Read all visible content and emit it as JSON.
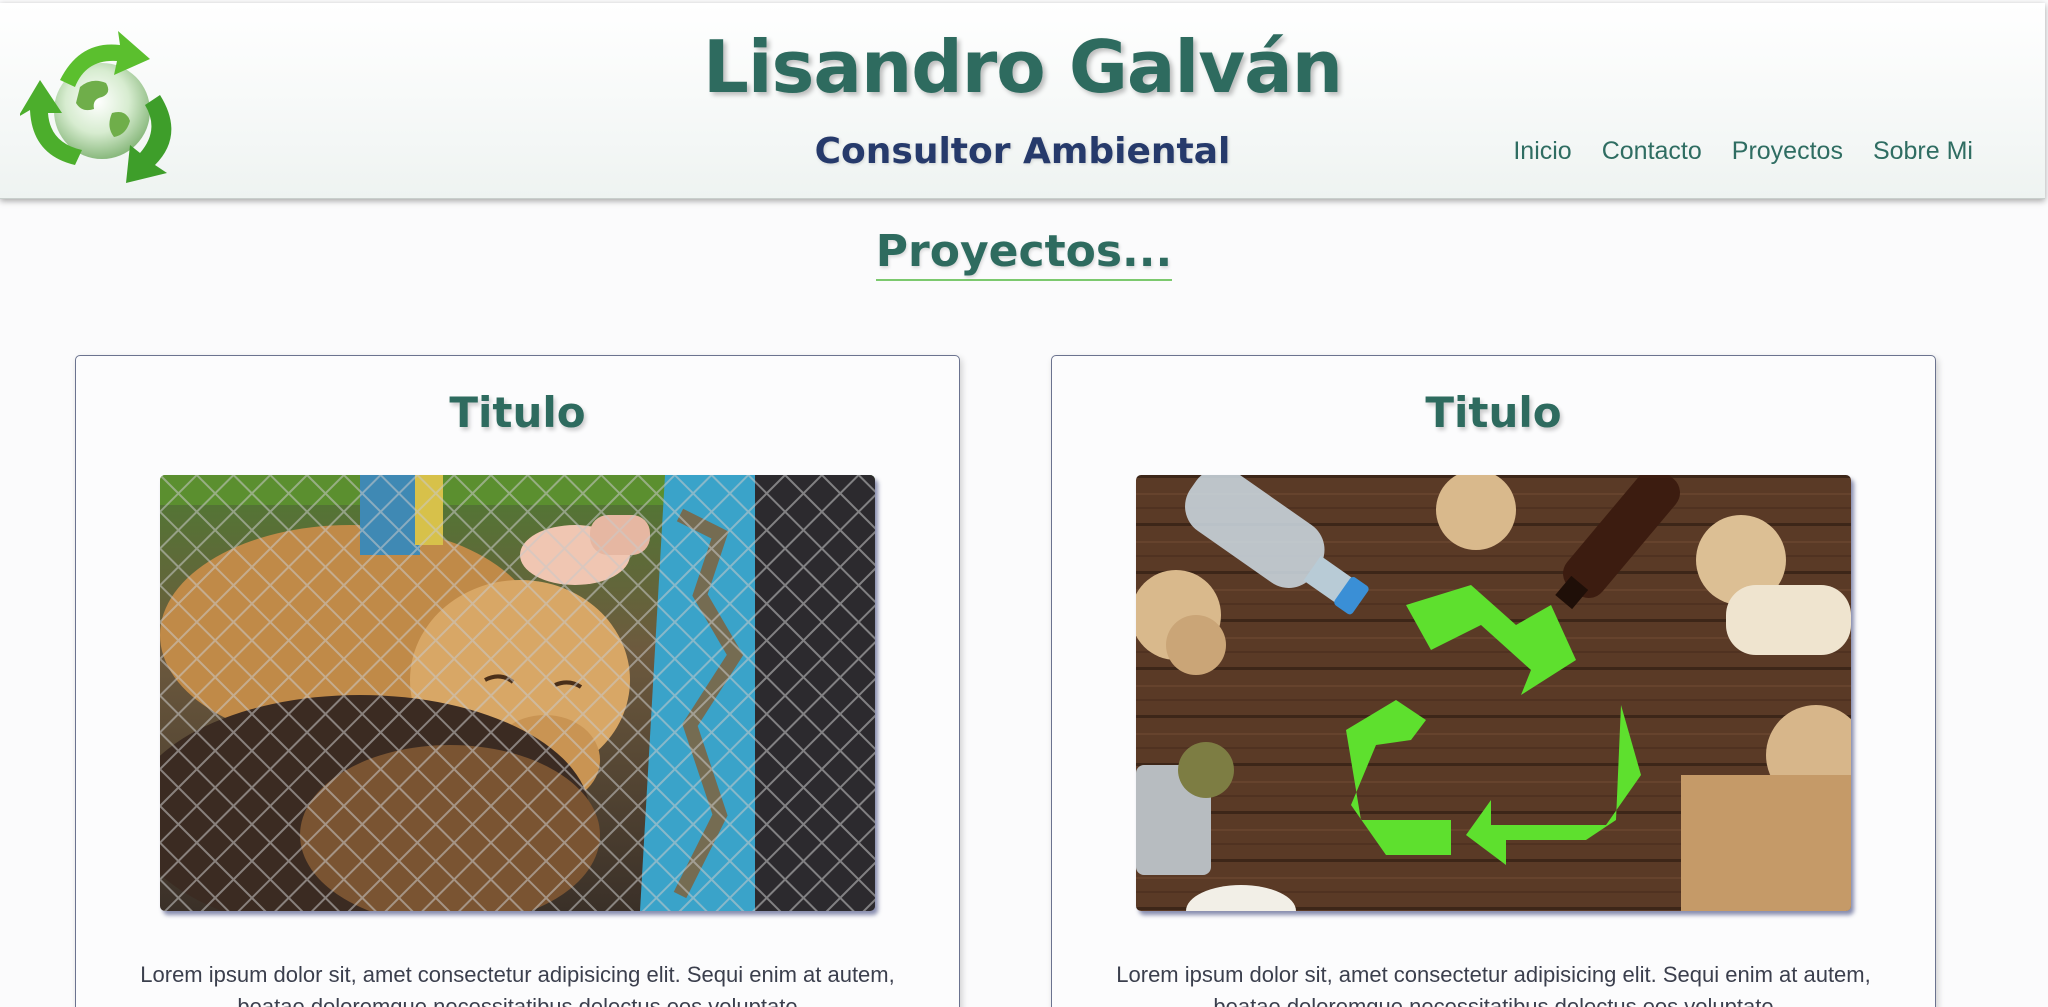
{
  "header": {
    "title": "Lisandro Galván",
    "subtitle": "Consultor Ambiental",
    "logo_icon": "recycle-globe-icon",
    "nav": [
      {
        "label": "Inicio"
      },
      {
        "label": "Contacto"
      },
      {
        "label": "Proyectos"
      },
      {
        "label": "Sobre Mi"
      }
    ]
  },
  "section": {
    "title": "Proyectos..."
  },
  "projects": [
    {
      "title": "Titulo",
      "image": "rescued-dogs-behind-fence-photo",
      "text": "Lorem ipsum dolor sit, amet consectetur adipisicing elit. Sequi enim at autem, beatae doloremque necessitatibus delectus eos voluptate"
    },
    {
      "title": "Titulo",
      "image": "recycling-symbol-with-waste-photo",
      "text": "Lorem ipsum dolor sit, amet consectetur adipisicing elit. Sequi enim at autem, beatae doloremque necessitatibus delectus eos voluptate"
    }
  ],
  "colors": {
    "primary_green": "#2e6b5f",
    "subtitle_navy": "#263a6b",
    "accent_green": "#7cc96e",
    "recycle_green": "#5ee02e"
  }
}
